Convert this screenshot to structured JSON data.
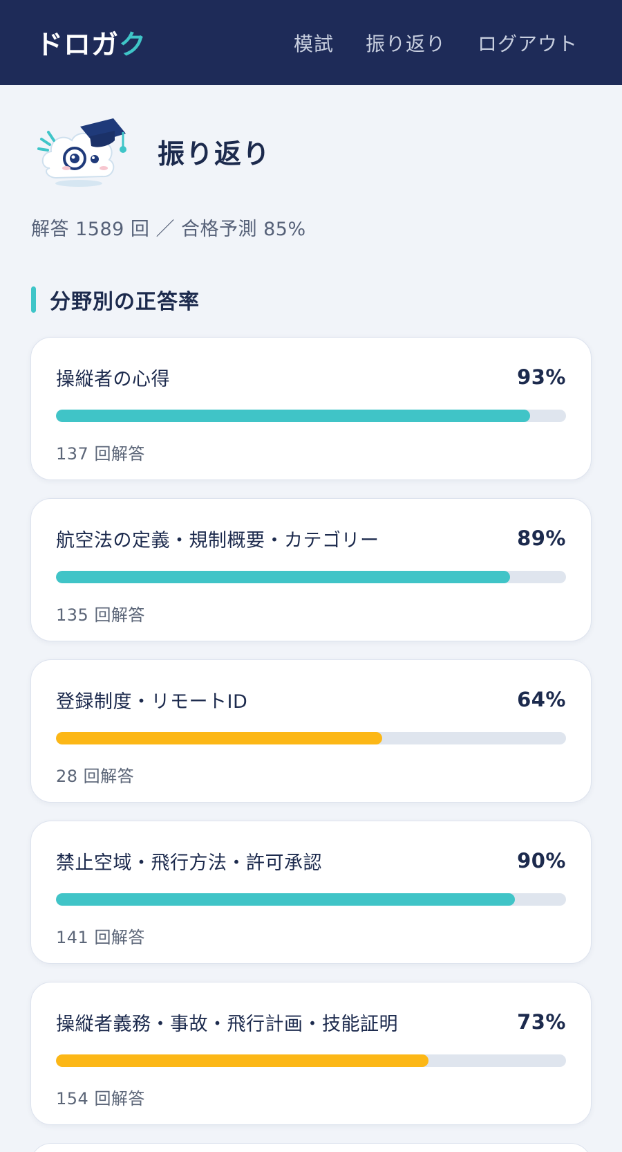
{
  "header": {
    "brand_main": "ドロガ",
    "brand_accent": "ク",
    "nav": [
      {
        "label": "模試"
      },
      {
        "label": "振り返り"
      },
      {
        "label": "ログアウト"
      }
    ]
  },
  "hero": {
    "title": "振り返り",
    "mascot_icon": "graduation-cap-cloud-mascot-icon"
  },
  "summary": "解答 1589 回 ／ 合格予測 85%",
  "section": {
    "title": "分野別の正答率"
  },
  "colors": {
    "high": "#40c4c7",
    "medium": "#fcb716",
    "header_bg": "#1e2b58",
    "accent": "#3fc5c8"
  },
  "categories": [
    {
      "label": "操縦者の心得",
      "percent": 93,
      "percent_text": "93%",
      "count_text": "137 回解答",
      "level": "high"
    },
    {
      "label": "航空法の定義・規制概要・カテゴリー",
      "percent": 89,
      "percent_text": "89%",
      "count_text": "135 回解答",
      "level": "high"
    },
    {
      "label": "登録制度・リモートID",
      "percent": 64,
      "percent_text": "64%",
      "count_text": "28 回解答",
      "level": "medium"
    },
    {
      "label": "禁止空域・飛行方法・許可承認",
      "percent": 90,
      "percent_text": "90%",
      "count_text": "141 回解答",
      "level": "high"
    },
    {
      "label": "操縦者義務・事故・飛行計画・技能証明",
      "percent": 73,
      "percent_text": "73%",
      "count_text": "154 回解答",
      "level": "medium"
    }
  ]
}
